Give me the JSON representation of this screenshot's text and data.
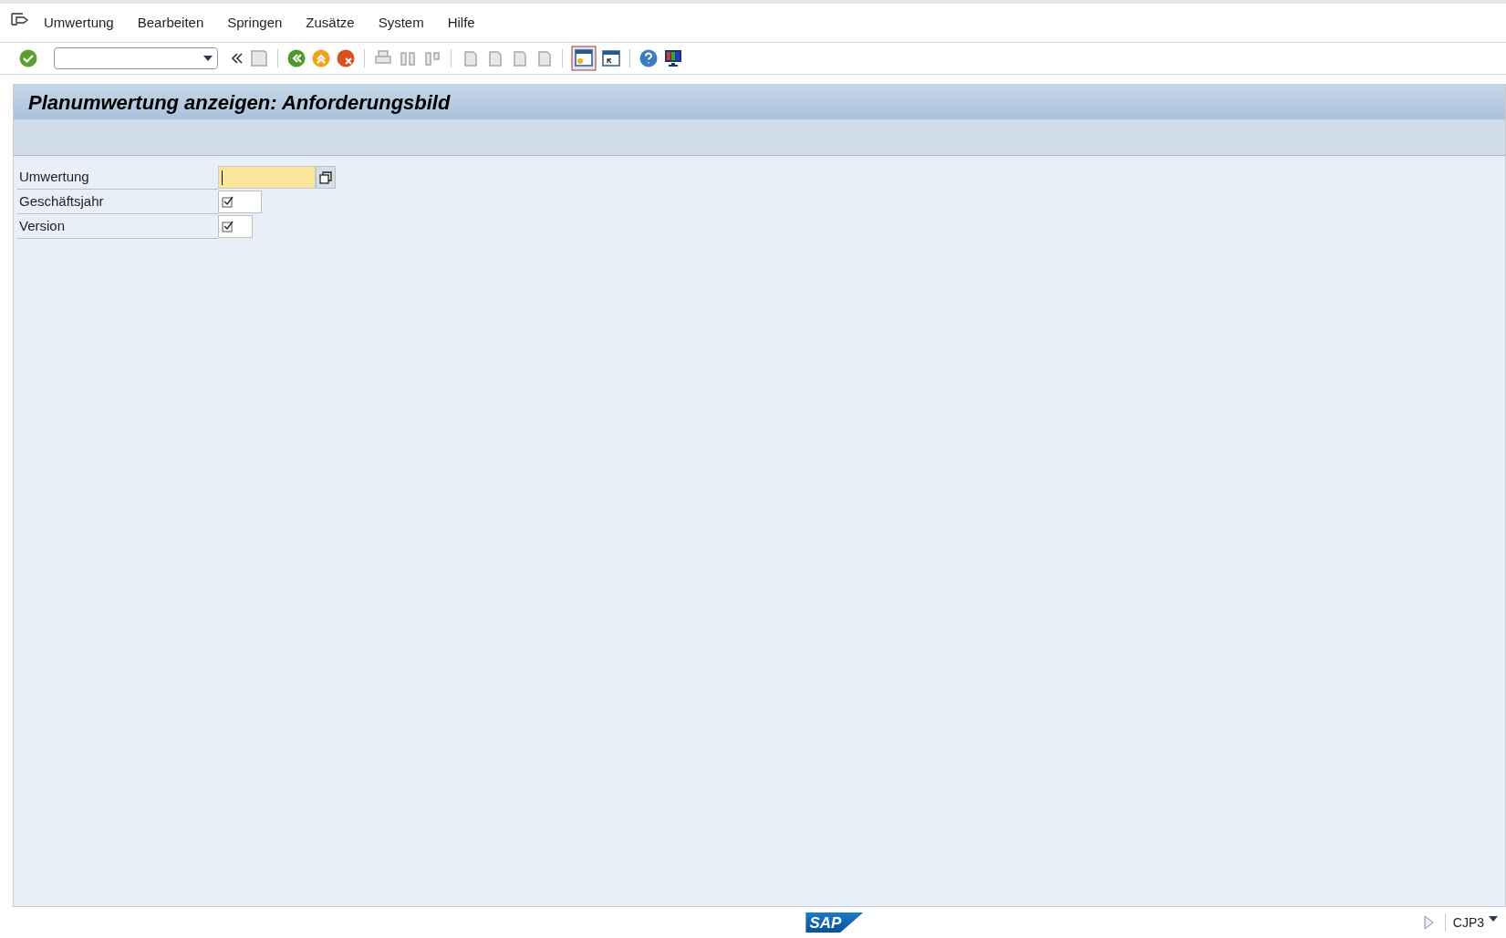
{
  "menu": [
    "Umwertung",
    "Bearbeiten",
    "Springen",
    "Zusätze",
    "System",
    "Hilfe"
  ],
  "title": "Planumwertung anzeigen: Anforderungsbild",
  "fields": [
    {
      "label": "Umwertung",
      "kind": "input"
    },
    {
      "label": "Geschäftsjahr",
      "kind": "required"
    },
    {
      "label": "Version",
      "kind": "required"
    }
  ],
  "footer": {
    "logo": "SAP",
    "transaction": "CJP3"
  }
}
